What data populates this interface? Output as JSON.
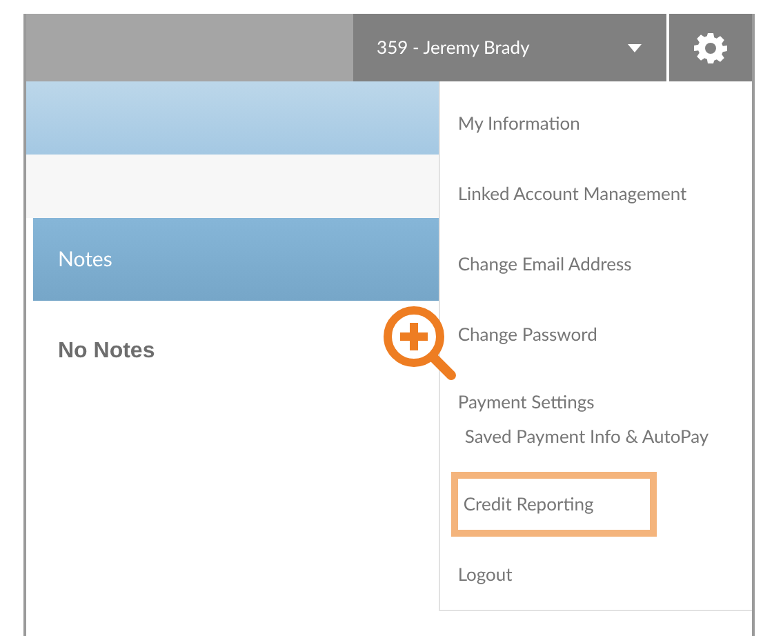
{
  "top_bar": {
    "user_menu": {
      "label": "359 - Jeremy Brady"
    }
  },
  "notes": {
    "title": "Notes",
    "empty_text": "No Notes"
  },
  "account_menu": [
    {
      "label": "My Information",
      "highlighted": false
    },
    {
      "label": "Linked Account Management",
      "highlighted": false
    },
    {
      "label": "Change Email Address",
      "highlighted": false
    },
    {
      "label": "Change Password",
      "highlighted": false
    },
    {
      "label": "Payment Settings",
      "sublabel": "Saved Payment Info & AutoPay",
      "highlighted": false
    },
    {
      "label": "Credit Reporting",
      "highlighted": true
    },
    {
      "label": "Logout",
      "highlighted": false
    }
  ]
}
